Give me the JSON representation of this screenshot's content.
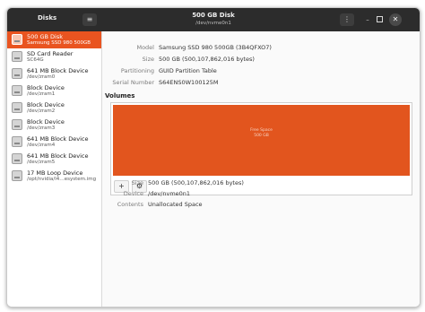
{
  "app": {
    "title": "Disks"
  },
  "window": {
    "title": "500 GB Disk",
    "subtitle": "/dev/nvme0n1"
  },
  "icons": {
    "menu": "hamburger-menu-icon",
    "kebab": "kebab-menu-icon",
    "minimize": "minimize-icon",
    "maximize": "maximize-icon",
    "close": "close-icon",
    "add": "plus-icon",
    "settings": "gears-icon",
    "drive": "drive-icon"
  },
  "glyphs": {
    "menu": "≡",
    "kebab": "⋮",
    "minimize": "–",
    "close": "✕",
    "add": "+",
    "settings": "⚙"
  },
  "colors": {
    "accent": "#e95420",
    "titlebar": "#2c2c2c",
    "partition": "#e2551e"
  },
  "devices": [
    {
      "name": "500 GB Disk",
      "sub": "Samsung SSD 980 500GB",
      "selected": true
    },
    {
      "name": "SD Card Reader",
      "sub": "SC64G"
    },
    {
      "name": "641 MB Block Device",
      "sub": "/dev/zram0"
    },
    {
      "name": "Block Device",
      "sub": "/dev/zram1"
    },
    {
      "name": "Block Device",
      "sub": "/dev/zram2"
    },
    {
      "name": "Block Device",
      "sub": "/dev/zram3"
    },
    {
      "name": "641 MB Block Device",
      "sub": "/dev/zram4"
    },
    {
      "name": "641 MB Block Device",
      "sub": "/dev/zram5"
    },
    {
      "name": "17 MB Loop Device",
      "sub": "/opt/nvidia/l4…esystem.img"
    }
  ],
  "disk_info": [
    {
      "label": "Model",
      "value": "Samsung SSD 980 500GB (3B4QFXO7)"
    },
    {
      "label": "Size",
      "value": "500 GB (500,107,862,016 bytes)"
    },
    {
      "label": "Partitioning",
      "value": "GUID Partition Table"
    },
    {
      "label": "Serial Number",
      "value": "S64ENS0W100125M"
    }
  ],
  "volumes": {
    "heading": "Volumes",
    "partition": {
      "name": "Free Space",
      "size": "500 GB"
    }
  },
  "volume_info": [
    {
      "label": "Size",
      "value": "500 GB (500,107,862,016 bytes)"
    },
    {
      "label": "Device",
      "value": "/dev/nvme0n1"
    },
    {
      "label": "Contents",
      "value": "Unallocated Space"
    }
  ]
}
